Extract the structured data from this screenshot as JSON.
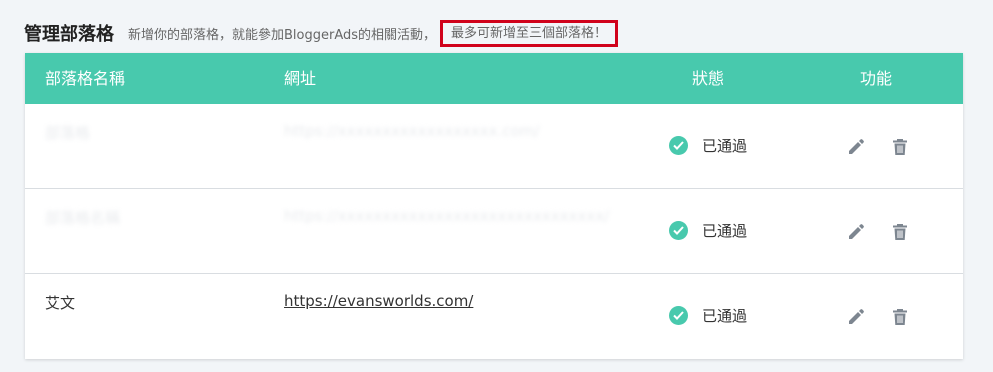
{
  "header": {
    "title": "管理部落格",
    "description": "新增你的部落格，就能參加BloggerAds的相關活動，",
    "limit_note": "最多可新增至三個部落格！"
  },
  "table": {
    "columns": {
      "name": "部落格名稱",
      "url": "網址",
      "status": "狀態",
      "actions": "功能"
    },
    "rows": [
      {
        "name": "部落格",
        "url": "https://xxxxxxxxxxxxxxxxxx.com/",
        "status": "已通過",
        "blurred": true
      },
      {
        "name": "部落格名稱",
        "url": "https://xxxxxxxxxxxxxxxxxxxxxxxxxxxxxx/",
        "status": "已通過",
        "blurred": true
      },
      {
        "name": "艾文",
        "url": "https://evansworlds.com/",
        "status": "已通過",
        "blurred": false
      }
    ]
  },
  "icons": {
    "status": "check-circle-icon",
    "edit": "pencil-icon",
    "delete": "trash-icon"
  },
  "colors": {
    "accent": "#48c9ad",
    "highlight_border": "#d0021b",
    "icon_gray": "#7d8690"
  }
}
